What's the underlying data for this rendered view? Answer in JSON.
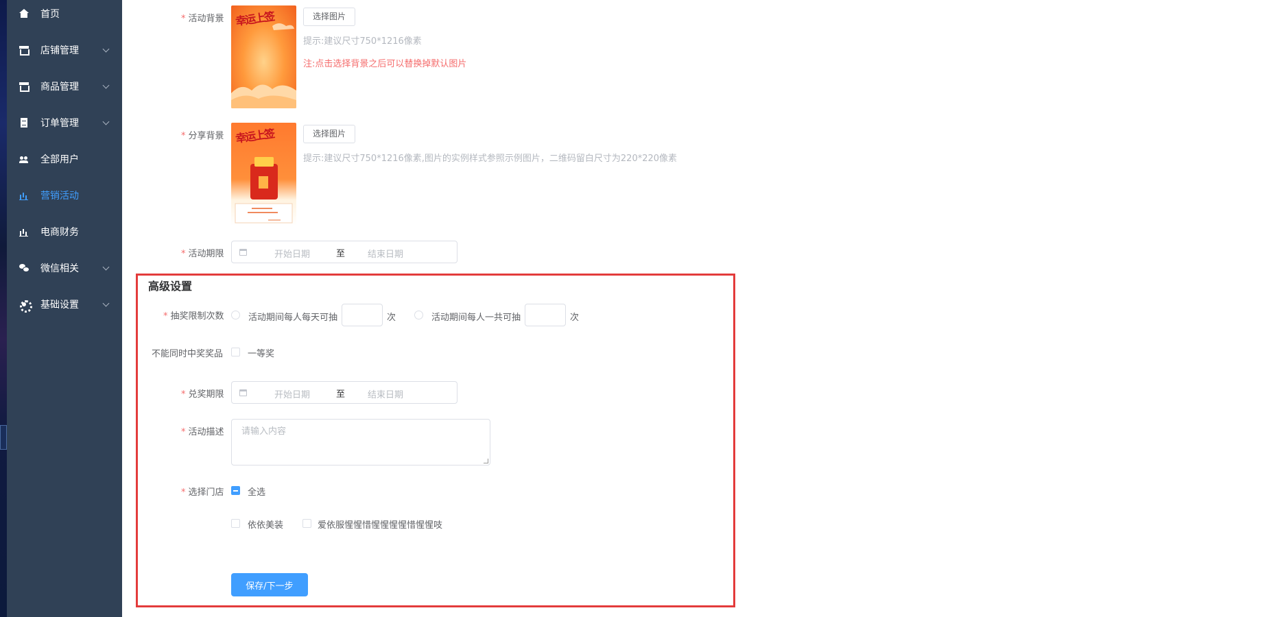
{
  "sidebar": {
    "items": [
      {
        "label": "首页",
        "icon": "home-icon"
      },
      {
        "label": "店铺管理",
        "icon": "store-icon"
      },
      {
        "label": "商品管理",
        "icon": "store-icon"
      },
      {
        "label": "订单管理",
        "icon": "document-icon"
      },
      {
        "label": "全部用户",
        "icon": "users-icon"
      },
      {
        "label": "营销活动",
        "icon": "bar-chart-icon",
        "active": true
      },
      {
        "label": "电商财务",
        "icon": "bar-chart-icon"
      },
      {
        "label": "微信相关",
        "icon": "wechat-icon"
      },
      {
        "label": "基础设置",
        "icon": "gear-icon"
      }
    ],
    "active_color": "#409eff",
    "bg_color": "#304156"
  },
  "form": {
    "activity_bg": {
      "label": "活动背景",
      "button": "选择图片",
      "hint": "提示:建议尺寸750*1216像素",
      "note": "注:点击选择背景之后可以替换掉默认图片",
      "thumb_text": "幸运上签"
    },
    "share_bg": {
      "label": "分享背景",
      "button": "选择图片",
      "hint": "提示:建议尺寸750*1216像素,图片的实例样式参照示例图片，二维码留白尺寸为220*220像素",
      "thumb_text": "幸运上签"
    },
    "activity_period": {
      "label": "活动期限",
      "start_placeholder": "开始日期",
      "separator": "至",
      "end_placeholder": "结束日期"
    }
  },
  "advanced": {
    "title": "高级设置",
    "draw_limit": {
      "label": "抽奖限制次数",
      "option1": "活动期间每人每天可抽",
      "unit1": "次",
      "option2": "活动期间每人一共可抽",
      "unit2": "次"
    },
    "no_multi_prize": {
      "label": "不能同时中奖奖品",
      "option": "一等奖"
    },
    "redeem_period": {
      "label": "兑奖期限",
      "start_placeholder": "开始日期",
      "separator": "至",
      "end_placeholder": "结束日期"
    },
    "description": {
      "label": "活动描述",
      "placeholder": "请输入内容"
    },
    "stores": {
      "label": "选择门店",
      "select_all": "全选",
      "options": [
        "依依美装",
        "爱依服惺惺惜惺惺惺惺惜惺惺吱"
      ]
    },
    "save_button": "保存/下一步",
    "highlight_color": "#e33b3b"
  }
}
